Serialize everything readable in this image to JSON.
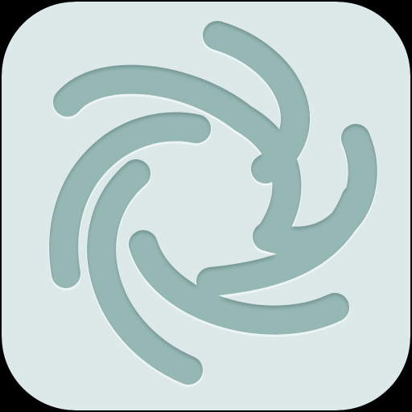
{
  "app_icon": {
    "name": "swirl-logo-icon",
    "shape": "rounded-square",
    "colors": {
      "outer_background": "#000000",
      "tile_background": "#dde8e8",
      "groove_fill": "#95b8b5",
      "groove_shadow": "#6f908d",
      "groove_highlight": "#f4f9f9"
    },
    "arm_count": 8
  }
}
